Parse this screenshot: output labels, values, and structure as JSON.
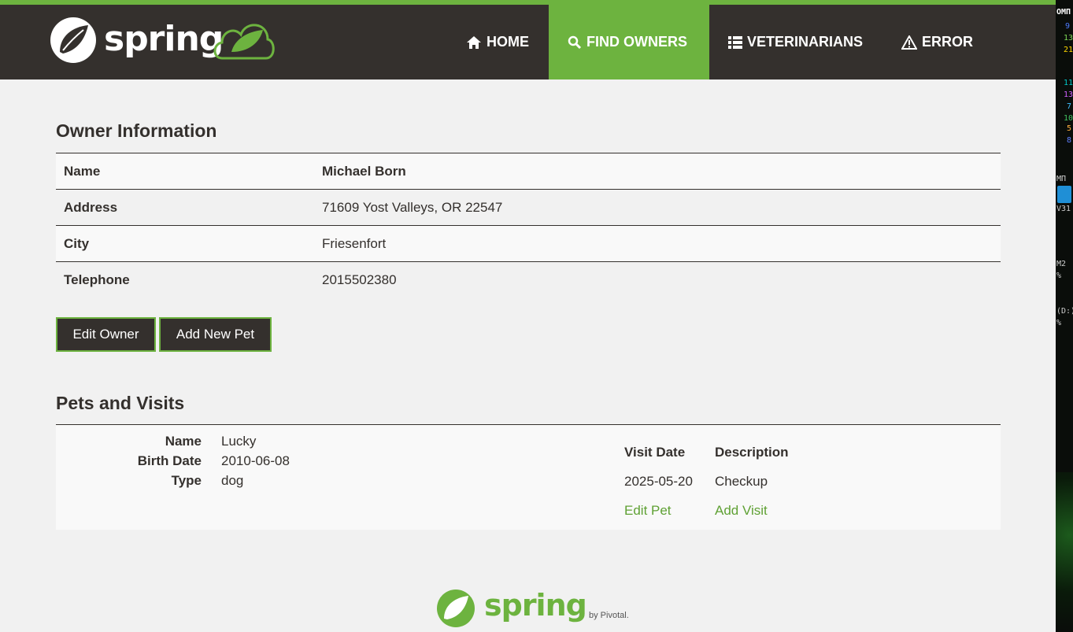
{
  "brand": {
    "name": "spring"
  },
  "nav": {
    "items": [
      {
        "label": "HOME",
        "icon": "home-icon",
        "active": false
      },
      {
        "label": "FIND OWNERS",
        "icon": "search-icon",
        "active": true
      },
      {
        "label": "VETERINARIANS",
        "icon": "list-icon",
        "active": false
      },
      {
        "label": "ERROR",
        "icon": "warning-icon",
        "active": false
      }
    ]
  },
  "owner": {
    "heading": "Owner Information",
    "rows": [
      {
        "label": "Name",
        "value": "Michael Born"
      },
      {
        "label": "Address",
        "value": "71609 Yost Valleys, OR 22547"
      },
      {
        "label": "City",
        "value": "Friesenfort"
      },
      {
        "label": "Telephone",
        "value": "2015502380"
      }
    ],
    "edit_label": "Edit Owner",
    "add_pet_label": "Add New Pet"
  },
  "pets": {
    "heading": "Pets and Visits",
    "pet": {
      "name_label": "Name",
      "name": "Lucky",
      "birth_label": "Birth Date",
      "birth": "2010-06-08",
      "type_label": "Type",
      "type": "dog"
    },
    "visits": {
      "date_header": "Visit Date",
      "desc_header": "Description",
      "rows": [
        {
          "date": "2025-05-20",
          "description": "Checkup"
        }
      ],
      "edit_pet_label": "Edit Pet",
      "add_visit_label": "Add Visit"
    }
  },
  "footer": {
    "brand": "spring",
    "by": "by Pivotal."
  },
  "side_strip": {
    "fragments": [
      "ОМП",
      "9",
      "13",
      "21",
      "11",
      "13",
      "7",
      "10",
      "5",
      "8",
      "МП",
      "V31",
      "М2",
      "%",
      "(D:)",
      "%"
    ]
  },
  "colors": {
    "accent": "#6db33f",
    "navbar": "#34302d",
    "background": "#f1f1f1",
    "link": "#5fa134"
  }
}
